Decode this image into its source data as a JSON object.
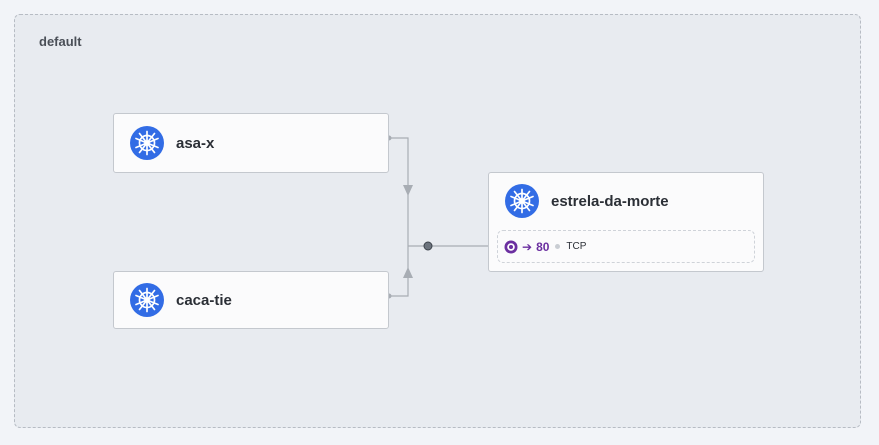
{
  "namespace": {
    "label": "default"
  },
  "nodes": {
    "asa_x": {
      "title": "asa-x",
      "icon": "kubernetes-icon"
    },
    "caca_tie": {
      "title": "caca-tie",
      "icon": "kubernetes-icon"
    },
    "estrela": {
      "title": "estrela-da-morte",
      "icon": "kubernetes-icon",
      "port": {
        "arrow": "➔",
        "number": "80",
        "protocol": "TCP"
      }
    }
  },
  "colors": {
    "k8s_blue": "#326ce5",
    "port_purple": "#6b2fa0",
    "edge_gray": "#a8adb4"
  }
}
